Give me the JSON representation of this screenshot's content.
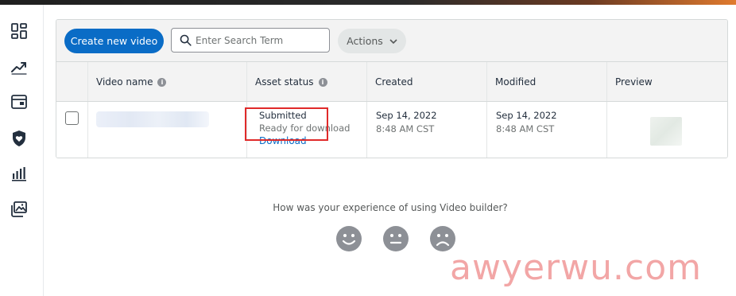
{
  "sidebar": {
    "items": [
      {
        "icon": "dashboard-icon"
      },
      {
        "icon": "trending-up-icon"
      },
      {
        "icon": "campaign-card-icon"
      },
      {
        "icon": "shield-heart-icon"
      },
      {
        "icon": "bar-chart-icon"
      },
      {
        "icon": "image-gallery-icon"
      }
    ]
  },
  "toolbar": {
    "create_label": "Create new video",
    "search_placeholder": "Enter Search Term",
    "actions_label": "Actions"
  },
  "table": {
    "columns": [
      "Video name",
      "Asset status",
      "Created",
      "Modified",
      "Preview"
    ],
    "rows": [
      {
        "status": "Submitted",
        "status_detail": "Ready for download",
        "action_link": "Download",
        "created_date": "Sep 14, 2022",
        "created_time": "8:48 AM CST",
        "modified_date": "Sep 14, 2022",
        "modified_time": "8:48 AM CST"
      }
    ]
  },
  "feedback": {
    "question": "How was your experience of using Video builder?",
    "options": [
      "happy-face-icon",
      "neutral-face-icon",
      "sad-face-icon"
    ]
  },
  "watermark": "awyerwu.com",
  "colors": {
    "primary": "#0a6cc6",
    "highlight": "#e02a2a",
    "watermark": "#f2a6a6",
    "icon": "#232f3e",
    "face": "#8d9096"
  }
}
